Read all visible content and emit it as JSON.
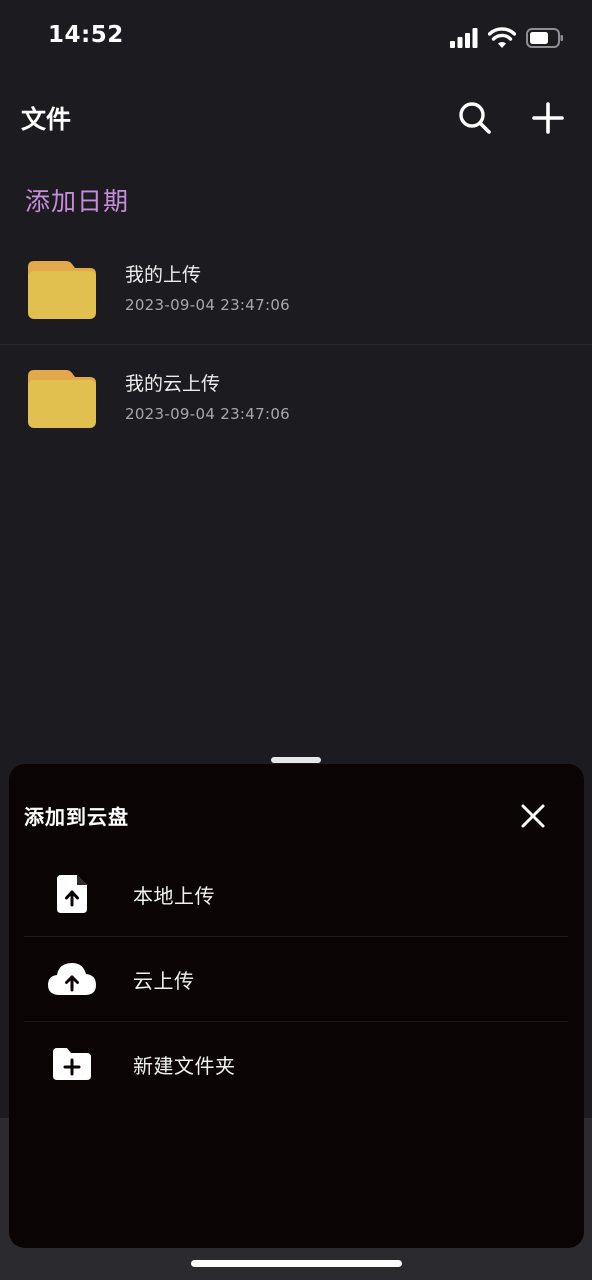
{
  "status_bar": {
    "time": "14:52"
  },
  "header": {
    "title": "文件"
  },
  "section": {
    "label": "添加日期"
  },
  "files": [
    {
      "name": "我的上传",
      "date": "2023-09-04 23:47:06"
    },
    {
      "name": "我的云上传",
      "date": "2023-09-04 23:47:06"
    }
  ],
  "sheet": {
    "title": "添加到云盘",
    "actions": [
      {
        "label": "本地上传",
        "icon": "file-upload-icon"
      },
      {
        "label": "云上传",
        "icon": "cloud-upload-icon"
      },
      {
        "label": "新建文件夹",
        "icon": "folder-add-icon"
      }
    ]
  },
  "colors": {
    "background": "#1c1b1f",
    "accent": "#c58ddb",
    "folder": "#e2c04f",
    "sheet_background": "#0b0405"
  }
}
